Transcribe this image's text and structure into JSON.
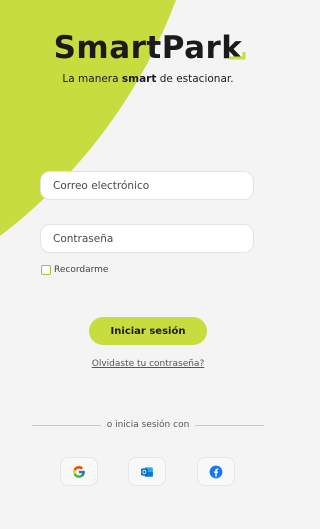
{
  "brand": {
    "name": "SmartPark",
    "tagline_before": "La manera ",
    "tagline_bold": "smart",
    "tagline_after": " de estacionar.",
    "accent_color": "#c6dc3f"
  },
  "form": {
    "email_placeholder": "Correo electrónico",
    "password_placeholder": "Contraseña",
    "remember_label": "Recordarme",
    "remember_checked": false,
    "login_label": "Iniciar sesión",
    "forgot_label": "Olvidaste tu contraseña?"
  },
  "social": {
    "divider_text": "o inicia sesión con",
    "providers": [
      {
        "icon": "google-icon"
      },
      {
        "icon": "outlook-icon"
      },
      {
        "icon": "facebook-icon"
      }
    ]
  }
}
